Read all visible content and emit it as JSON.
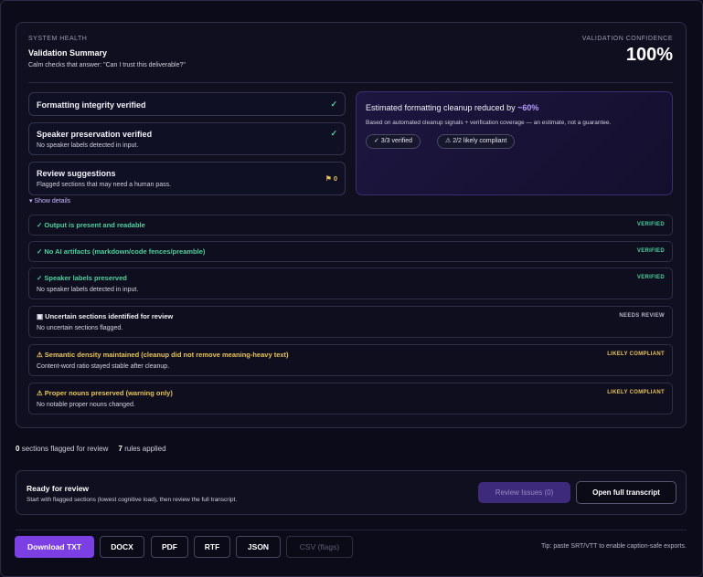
{
  "header": {
    "eyebrow": "SYSTEM HEALTH",
    "title": "Validation Summary",
    "subtitle": "Calm checks that answer: \"Can I trust this deliverable?\"",
    "confidence_label": "VALIDATION CONFIDENCE",
    "confidence_value": "100%"
  },
  "summary_cards": [
    {
      "title": "Formatting integrity verified",
      "subtitle": "",
      "status": "✓"
    },
    {
      "title": "Speaker preservation verified",
      "subtitle": "No speaker labels detected in input.",
      "status": "✓"
    },
    {
      "title": "Review suggestions",
      "subtitle": "Flagged sections that may need a human pass.",
      "status": "⚑ 0"
    }
  ],
  "estimate": {
    "title_prefix": "Estimated formatting cleanup reduced by",
    "percent": "~60%",
    "subtitle": "Based on automated cleanup signals + verification coverage — an estimate, not a guarantee.",
    "pill_verified": "✓ 3/3 verified",
    "pill_compliant": "⚠ 2/2 likely compliant"
  },
  "show_details": "▾ Show details",
  "checks": [
    {
      "title": "✓ Output is present and readable",
      "subtitle": "",
      "badge": "VERIFIED",
      "tone": "green"
    },
    {
      "title": "✓ No AI artifacts (markdown/code fences/preamble)",
      "subtitle": "",
      "badge": "VERIFIED",
      "tone": "green"
    },
    {
      "title": "✓ Speaker labels preserved",
      "subtitle": "No speaker labels detected in input.",
      "badge": "VERIFIED",
      "tone": "green"
    },
    {
      "title": "▣ Uncertain sections identified for review",
      "subtitle": "No uncertain sections flagged.",
      "badge": "NEEDS REVIEW",
      "tone": "white"
    },
    {
      "title": "⚠ Semantic density maintained (cleanup did not remove meaning-heavy text)",
      "subtitle": "Content-word ratio stayed stable after cleanup.",
      "badge": "LIKELY COMPLIANT",
      "tone": "yellow"
    },
    {
      "title": "⚠ Proper nouns preserved (warning only)",
      "subtitle": "No notable proper nouns changed.",
      "badge": "LIKELY COMPLIANT",
      "tone": "yellow"
    }
  ],
  "stats": {
    "flagged_count": "0",
    "flagged_label": "sections flagged for review",
    "rules_count": "7",
    "rules_label": "rules applied"
  },
  "ready": {
    "title": "Ready for review",
    "subtitle": "Start with flagged sections (lowest cognitive load), then review the full transcript.",
    "review_button": "Review Issues (0)",
    "open_button": "Open full transcript"
  },
  "exports": {
    "download": "Download TXT",
    "docx": "DOCX",
    "pdf": "PDF",
    "rtf": "RTF",
    "json": "JSON",
    "csv": "CSV (flags)",
    "tip": "Tip: paste SRT/VTT to enable caption-safe exports."
  },
  "colors": {
    "accent": "#7b3fe4",
    "verified": "#4fd1a0",
    "warning": "#e8c45a",
    "background": "#0b0b1a"
  }
}
